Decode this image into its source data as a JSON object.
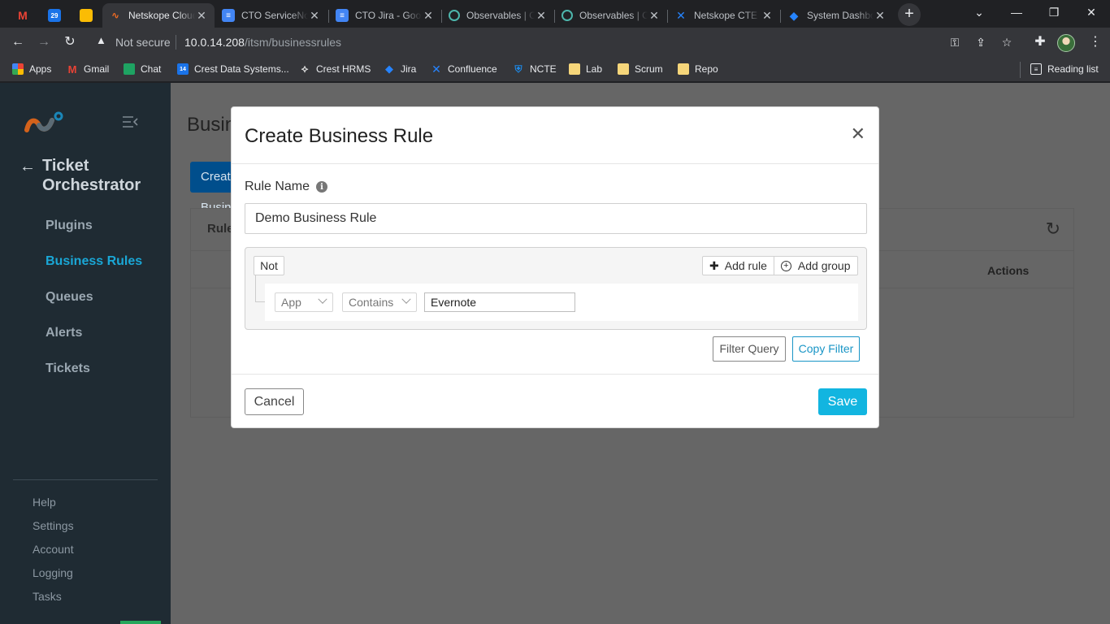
{
  "browser": {
    "tabs": [
      {
        "title": "",
        "icon": "gmail-icon",
        "pinned": true
      },
      {
        "title": "",
        "icon": "calendar-icon",
        "pinned": true,
        "badge": "29"
      },
      {
        "title": "",
        "icon": "keep-icon",
        "pinned": true
      },
      {
        "title": "Netskope Cloud Exchange",
        "icon": "netskope-icon",
        "active": true
      },
      {
        "title": "CTO ServiceNow",
        "icon": "docs-icon"
      },
      {
        "title": "CTO Jira - Google Docs",
        "icon": "docs-icon"
      },
      {
        "title": "Observables | Cortex",
        "icon": "observables-icon"
      },
      {
        "title": "Observables | Cortex",
        "icon": "observables-icon"
      },
      {
        "title": "Netskope CTE",
        "icon": "confluence-icon"
      },
      {
        "title": "System Dashboard",
        "icon": "jira-icon"
      }
    ],
    "address": {
      "security_label": "Not secure",
      "host": "10.0.14.208",
      "path": "/itsm/businessrules"
    },
    "bookmarks": [
      {
        "label": "Apps",
        "icon": "apps-grid-icon"
      },
      {
        "label": "Gmail",
        "icon": "gmail-icon"
      },
      {
        "label": "Chat",
        "icon": "chat-icon"
      },
      {
        "label": "Crest Data Systems...",
        "icon": "calendar-icon"
      },
      {
        "label": "Crest HRMS",
        "icon": "crest-icon"
      },
      {
        "label": "Jira",
        "icon": "jira-icon"
      },
      {
        "label": "Confluence",
        "icon": "confluence-icon"
      },
      {
        "label": "NCTE",
        "icon": "shield-icon"
      },
      {
        "label": "Lab",
        "icon": "folder-icon"
      },
      {
        "label": "Scrum",
        "icon": "folder-icon"
      },
      {
        "label": "Repo",
        "icon": "folder-icon"
      }
    ],
    "reading_list": "Reading list"
  },
  "sidebar": {
    "app_title": "Ticket Orchestrator",
    "items": [
      {
        "label": "Plugins",
        "active": false
      },
      {
        "label": "Business Rules",
        "active": true
      },
      {
        "label": "Queues",
        "active": false
      },
      {
        "label": "Alerts",
        "active": false
      },
      {
        "label": "Tickets",
        "active": false
      }
    ],
    "footer": [
      "Help",
      "Settings",
      "Account",
      "Logging",
      "Tasks"
    ]
  },
  "page": {
    "title": "Business Rules",
    "create_button": "Create Business Rule",
    "card_label": "Rules",
    "actions_header": "Actions"
  },
  "modal": {
    "title": "Create Business Rule",
    "rule_name_label": "Rule Name",
    "rule_name_value": "Demo Business Rule",
    "query": {
      "not_label": "Not",
      "add_rule": "Add rule",
      "add_group": "Add group",
      "field": "App",
      "operator": "Contains",
      "value": "Evernote"
    },
    "filter_query": "Filter Query",
    "copy_filter": "Copy Filter",
    "cancel": "Cancel",
    "save": "Save"
  },
  "colors": {
    "accent": "#12b5e0",
    "sidebar_bg": "#1f2b33",
    "active_nav": "#1aa7d6"
  }
}
